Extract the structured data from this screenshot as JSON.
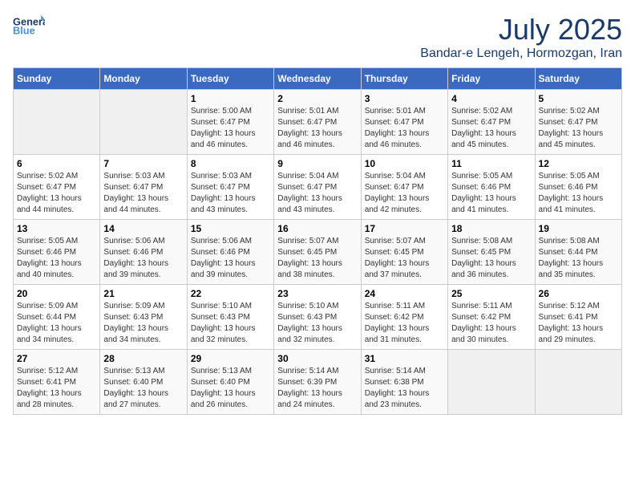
{
  "header": {
    "logo_general": "General",
    "logo_blue": "Blue",
    "month": "July 2025",
    "location": "Bandar-e Lengeh, Hormozgan, Iran"
  },
  "weekdays": [
    "Sunday",
    "Monday",
    "Tuesday",
    "Wednesday",
    "Thursday",
    "Friday",
    "Saturday"
  ],
  "weeks": [
    [
      {
        "day": "",
        "sunrise": "",
        "sunset": "",
        "daylight": ""
      },
      {
        "day": "",
        "sunrise": "",
        "sunset": "",
        "daylight": ""
      },
      {
        "day": "1",
        "sunrise": "Sunrise: 5:00 AM",
        "sunset": "Sunset: 6:47 PM",
        "daylight": "Daylight: 13 hours and 46 minutes."
      },
      {
        "day": "2",
        "sunrise": "Sunrise: 5:01 AM",
        "sunset": "Sunset: 6:47 PM",
        "daylight": "Daylight: 13 hours and 46 minutes."
      },
      {
        "day": "3",
        "sunrise": "Sunrise: 5:01 AM",
        "sunset": "Sunset: 6:47 PM",
        "daylight": "Daylight: 13 hours and 46 minutes."
      },
      {
        "day": "4",
        "sunrise": "Sunrise: 5:02 AM",
        "sunset": "Sunset: 6:47 PM",
        "daylight": "Daylight: 13 hours and 45 minutes."
      },
      {
        "day": "5",
        "sunrise": "Sunrise: 5:02 AM",
        "sunset": "Sunset: 6:47 PM",
        "daylight": "Daylight: 13 hours and 45 minutes."
      }
    ],
    [
      {
        "day": "6",
        "sunrise": "Sunrise: 5:02 AM",
        "sunset": "Sunset: 6:47 PM",
        "daylight": "Daylight: 13 hours and 44 minutes."
      },
      {
        "day": "7",
        "sunrise": "Sunrise: 5:03 AM",
        "sunset": "Sunset: 6:47 PM",
        "daylight": "Daylight: 13 hours and 44 minutes."
      },
      {
        "day": "8",
        "sunrise": "Sunrise: 5:03 AM",
        "sunset": "Sunset: 6:47 PM",
        "daylight": "Daylight: 13 hours and 43 minutes."
      },
      {
        "day": "9",
        "sunrise": "Sunrise: 5:04 AM",
        "sunset": "Sunset: 6:47 PM",
        "daylight": "Daylight: 13 hours and 43 minutes."
      },
      {
        "day": "10",
        "sunrise": "Sunrise: 5:04 AM",
        "sunset": "Sunset: 6:47 PM",
        "daylight": "Daylight: 13 hours and 42 minutes."
      },
      {
        "day": "11",
        "sunrise": "Sunrise: 5:05 AM",
        "sunset": "Sunset: 6:46 PM",
        "daylight": "Daylight: 13 hours and 41 minutes."
      },
      {
        "day": "12",
        "sunrise": "Sunrise: 5:05 AM",
        "sunset": "Sunset: 6:46 PM",
        "daylight": "Daylight: 13 hours and 41 minutes."
      }
    ],
    [
      {
        "day": "13",
        "sunrise": "Sunrise: 5:05 AM",
        "sunset": "Sunset: 6:46 PM",
        "daylight": "Daylight: 13 hours and 40 minutes."
      },
      {
        "day": "14",
        "sunrise": "Sunrise: 5:06 AM",
        "sunset": "Sunset: 6:46 PM",
        "daylight": "Daylight: 13 hours and 39 minutes."
      },
      {
        "day": "15",
        "sunrise": "Sunrise: 5:06 AM",
        "sunset": "Sunset: 6:46 PM",
        "daylight": "Daylight: 13 hours and 39 minutes."
      },
      {
        "day": "16",
        "sunrise": "Sunrise: 5:07 AM",
        "sunset": "Sunset: 6:45 PM",
        "daylight": "Daylight: 13 hours and 38 minutes."
      },
      {
        "day": "17",
        "sunrise": "Sunrise: 5:07 AM",
        "sunset": "Sunset: 6:45 PM",
        "daylight": "Daylight: 13 hours and 37 minutes."
      },
      {
        "day": "18",
        "sunrise": "Sunrise: 5:08 AM",
        "sunset": "Sunset: 6:45 PM",
        "daylight": "Daylight: 13 hours and 36 minutes."
      },
      {
        "day": "19",
        "sunrise": "Sunrise: 5:08 AM",
        "sunset": "Sunset: 6:44 PM",
        "daylight": "Daylight: 13 hours and 35 minutes."
      }
    ],
    [
      {
        "day": "20",
        "sunrise": "Sunrise: 5:09 AM",
        "sunset": "Sunset: 6:44 PM",
        "daylight": "Daylight: 13 hours and 34 minutes."
      },
      {
        "day": "21",
        "sunrise": "Sunrise: 5:09 AM",
        "sunset": "Sunset: 6:43 PM",
        "daylight": "Daylight: 13 hours and 34 minutes."
      },
      {
        "day": "22",
        "sunrise": "Sunrise: 5:10 AM",
        "sunset": "Sunset: 6:43 PM",
        "daylight": "Daylight: 13 hours and 32 minutes."
      },
      {
        "day": "23",
        "sunrise": "Sunrise: 5:10 AM",
        "sunset": "Sunset: 6:43 PM",
        "daylight": "Daylight: 13 hours and 32 minutes."
      },
      {
        "day": "24",
        "sunrise": "Sunrise: 5:11 AM",
        "sunset": "Sunset: 6:42 PM",
        "daylight": "Daylight: 13 hours and 31 minutes."
      },
      {
        "day": "25",
        "sunrise": "Sunrise: 5:11 AM",
        "sunset": "Sunset: 6:42 PM",
        "daylight": "Daylight: 13 hours and 30 minutes."
      },
      {
        "day": "26",
        "sunrise": "Sunrise: 5:12 AM",
        "sunset": "Sunset: 6:41 PM",
        "daylight": "Daylight: 13 hours and 29 minutes."
      }
    ],
    [
      {
        "day": "27",
        "sunrise": "Sunrise: 5:12 AM",
        "sunset": "Sunset: 6:41 PM",
        "daylight": "Daylight: 13 hours and 28 minutes."
      },
      {
        "day": "28",
        "sunrise": "Sunrise: 5:13 AM",
        "sunset": "Sunset: 6:40 PM",
        "daylight": "Daylight: 13 hours and 27 minutes."
      },
      {
        "day": "29",
        "sunrise": "Sunrise: 5:13 AM",
        "sunset": "Sunset: 6:40 PM",
        "daylight": "Daylight: 13 hours and 26 minutes."
      },
      {
        "day": "30",
        "sunrise": "Sunrise: 5:14 AM",
        "sunset": "Sunset: 6:39 PM",
        "daylight": "Daylight: 13 hours and 24 minutes."
      },
      {
        "day": "31",
        "sunrise": "Sunrise: 5:14 AM",
        "sunset": "Sunset: 6:38 PM",
        "daylight": "Daylight: 13 hours and 23 minutes."
      },
      {
        "day": "",
        "sunrise": "",
        "sunset": "",
        "daylight": ""
      },
      {
        "day": "",
        "sunrise": "",
        "sunset": "",
        "daylight": ""
      }
    ]
  ]
}
